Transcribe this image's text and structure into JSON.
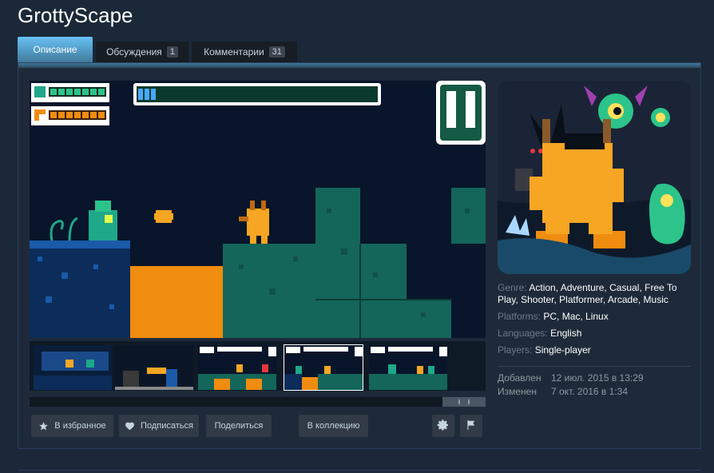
{
  "page": {
    "title": "GrottyScape"
  },
  "tabs": [
    {
      "label": "Описание",
      "active": true
    },
    {
      "label": "Обсуждения",
      "count": "1"
    },
    {
      "label": "Комментарии",
      "count": "31"
    }
  ],
  "game_hud": {
    "pause_icon": "pause-icon",
    "health_icon": "heart-icon",
    "ammo_icon": "gun-icon"
  },
  "actions": {
    "wishlist": "В избранное",
    "follow": "Подписаться",
    "share": "Поделиться",
    "collection": "В коллекцию",
    "settings_icon": "gear-icon",
    "flag_icon": "flag-icon"
  },
  "info": {
    "genre_label": "Genre:",
    "genres": "Action, Adventure, Casual, Free To Play, Shooter, Platformer, Arcade, Music",
    "platforms_label": "Platforms:",
    "platforms": "PC, Mac, Linux",
    "languages_label": "Languages:",
    "languages": "English",
    "players_label": "Players:",
    "players": "Single-player"
  },
  "dates": {
    "added_label": "Добавлен",
    "added": "12 июл. 2015 в 13:29",
    "changed_label": "Изменен",
    "changed": "7 окт. 2016 в 1:34"
  },
  "colors": {
    "accent": "#67c1f5",
    "background": "#1b2838",
    "slime": "#1fa88a",
    "lava": "#f08c10",
    "robot": "#f6a623"
  }
}
